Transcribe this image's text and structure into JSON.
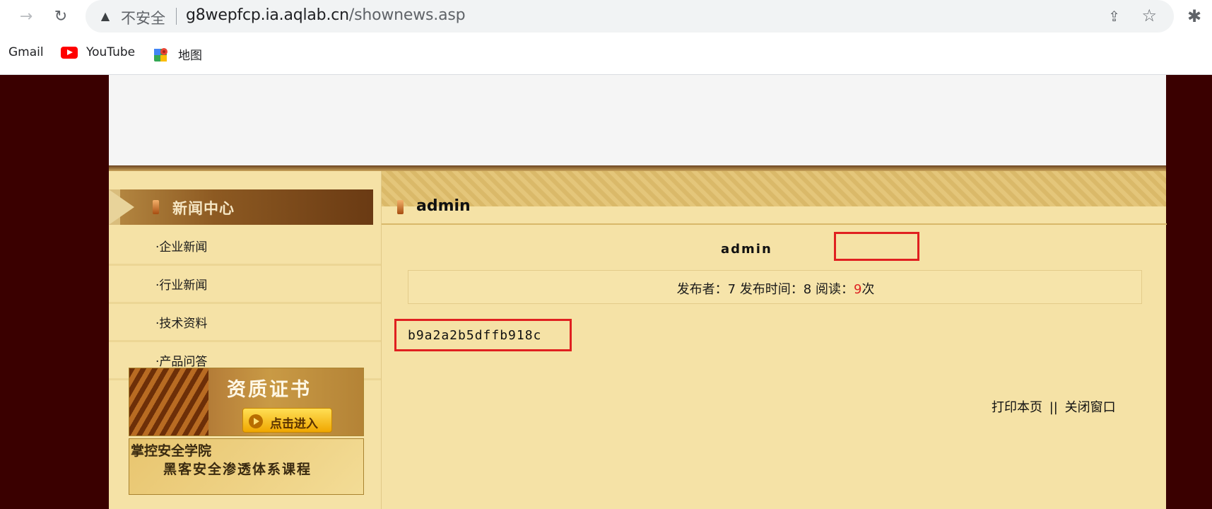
{
  "browser": {
    "insecure_label": "不安全",
    "url_host": "g8wepfcp.ia.aqlab.cn",
    "url_path": "/shownews.asp",
    "bookmarks": [
      {
        "label": "Gmail"
      },
      {
        "label": "YouTube"
      },
      {
        "label": "地图"
      }
    ]
  },
  "sidebar": {
    "title": "新闻中心",
    "items": [
      {
        "label": "·企业新闻"
      },
      {
        "label": "·行业新闻"
      },
      {
        "label": "·技术资料"
      },
      {
        "label": "·产品问答"
      }
    ],
    "cert_banner": {
      "title": "资质证书",
      "button_label": "点击进入"
    },
    "school_banner": {
      "title": "掌控安全学院",
      "subtitle": "黑客安全渗透体系课程"
    }
  },
  "main": {
    "section_title": "admin",
    "article_title": "admin",
    "meta": {
      "publisher_label": "发布者：",
      "publisher_value": "7",
      "time_label": "发布时间：",
      "time_value": "8",
      "read_label": "阅读：",
      "read_count": "9",
      "read_suffix": "次"
    },
    "content": "b9a2a2b5dffb918c",
    "actions": {
      "print": "打印本页",
      "separator": "||",
      "close": "关闭窗口"
    }
  },
  "colors": {
    "page_background": "#3a0000",
    "content_background": "#f5e2a6",
    "highlight_border": "#e02020",
    "read_count": "#dd2222"
  }
}
